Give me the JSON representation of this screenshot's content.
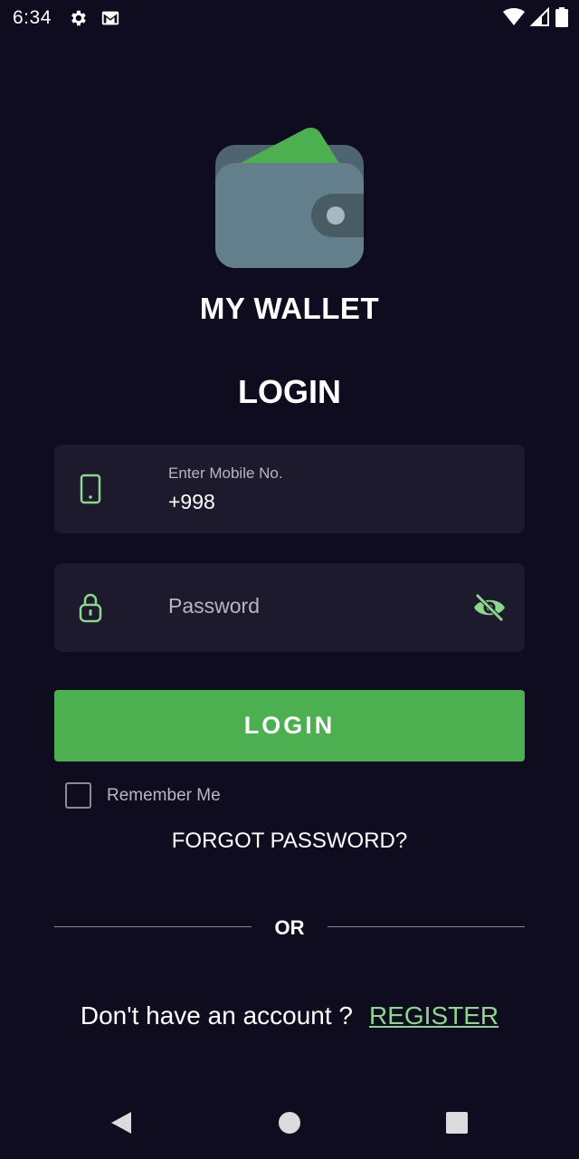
{
  "status_bar": {
    "time": "6:34",
    "icons": [
      "settings-icon",
      "gmail-icon",
      "wifi-icon",
      "signal-icon",
      "battery-icon"
    ]
  },
  "app": {
    "name": "MY WALLET",
    "logo_icon": "wallet-icon"
  },
  "login": {
    "title": "LOGIN",
    "phone_field": {
      "label": "Enter Mobile No.",
      "value": "+998",
      "icon": "phone-icon"
    },
    "password_field": {
      "placeholder": "Password",
      "icon": "lock-icon",
      "toggle_icon": "eye-off-icon"
    },
    "submit_label": "LOGIN",
    "remember_label": "Remember Me",
    "remember_checked": false,
    "forgot_label": "FORGOT PASSWORD?",
    "or_label": "OR",
    "register_prompt": "Don't have an account ?",
    "register_label": "REGISTER"
  },
  "nav_bar": {
    "buttons": [
      "back-icon",
      "home-icon",
      "recents-icon"
    ]
  },
  "colors": {
    "background": "#0f0c1f",
    "field_bg": "#1c1a2c",
    "accent": "#4caf50",
    "icon_green": "#8ed68f",
    "link_green": "#8ed68f"
  }
}
